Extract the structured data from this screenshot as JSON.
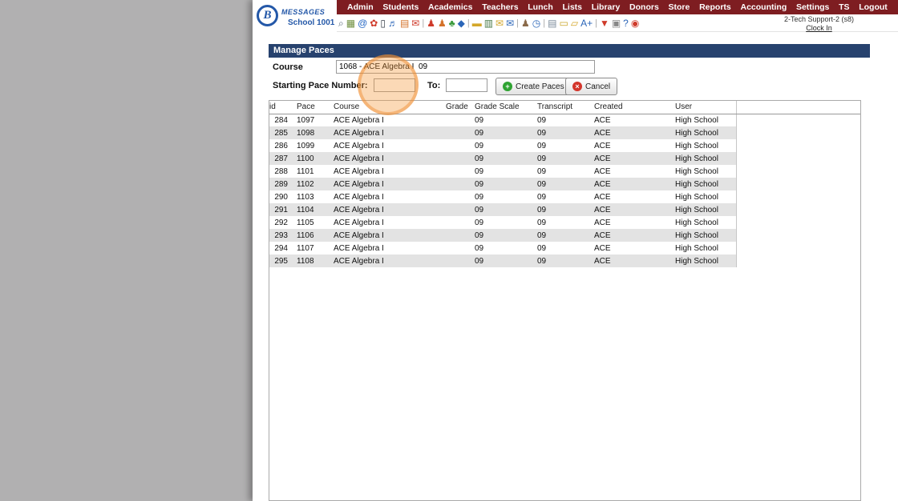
{
  "logo": {
    "initial": "B",
    "brand": "MESSAGES",
    "school": "School 1001"
  },
  "nav": {
    "items": [
      "Admin",
      "Students",
      "Academics",
      "Teachers",
      "Lunch",
      "Lists",
      "Library",
      "Donors",
      "Store",
      "Reports",
      "Accounting",
      "Settings",
      "TS",
      "Logout"
    ]
  },
  "toolbar": {
    "icons": [
      {
        "name": "search-icon",
        "glyph": "⌕",
        "color": "#5a6b7a"
      },
      {
        "name": "calendar-grid-icon",
        "glyph": "▦",
        "color": "#6f8f3f"
      },
      {
        "name": "at-icon",
        "glyph": "@",
        "color": "#1f63c4"
      },
      {
        "name": "flower-icon",
        "glyph": "✿",
        "color": "#cf3a2a"
      },
      {
        "name": "mobile-phone-icon",
        "glyph": "▯",
        "color": "#333a44"
      },
      {
        "name": "speaker-icon",
        "glyph": "♬",
        "color": "#2b66b8"
      },
      {
        "name": "calendar-icon",
        "glyph": "▤",
        "color": "#d4722a"
      },
      {
        "name": "mail-icon",
        "glyph": "✉",
        "color": "#cf3a2a"
      },
      {
        "name": "separator",
        "glyph": "|",
        "color": "#aaa"
      },
      {
        "name": "person-red-icon",
        "glyph": "♟",
        "color": "#cf3a2a"
      },
      {
        "name": "person-orange-icon",
        "glyph": "♟",
        "color": "#d4722a"
      },
      {
        "name": "leaf-icon",
        "glyph": "♣",
        "color": "#3a9a3a"
      },
      {
        "name": "bird-icon",
        "glyph": "◆",
        "color": "#2b66b8"
      },
      {
        "name": "separator",
        "glyph": "|",
        "color": "#aaa"
      },
      {
        "name": "briefcase-icon",
        "glyph": "▬",
        "color": "#d4a72a"
      },
      {
        "name": "notebook-icon",
        "glyph": "▥",
        "color": "#4a7a4a"
      },
      {
        "name": "mail-yellow-icon",
        "glyph": "✉",
        "color": "#d4a72a"
      },
      {
        "name": "mail-blue-icon",
        "glyph": "✉",
        "color": "#2b66b8"
      },
      {
        "name": "separator",
        "glyph": "|",
        "color": "#aaa"
      },
      {
        "name": "person-brown-icon",
        "glyph": "♟",
        "color": "#8a6a4a"
      },
      {
        "name": "clock-icon",
        "glyph": "◷",
        "color": "#2b66b8"
      },
      {
        "name": "separator",
        "glyph": "|",
        "color": "#aaa"
      },
      {
        "name": "ledger-icon",
        "glyph": "▤",
        "color": "#7a8a9a"
      },
      {
        "name": "card-icon",
        "glyph": "▭",
        "color": "#caa52a"
      },
      {
        "name": "folder-icon",
        "glyph": "▱",
        "color": "#d4a72a"
      },
      {
        "name": "grade-aplus-icon",
        "glyph": "A+",
        "color": "#2b66b8"
      },
      {
        "name": "separator",
        "glyph": "|",
        "color": "#aaa"
      },
      {
        "name": "pdf-icon",
        "glyph": "▼",
        "color": "#cf3a2a"
      },
      {
        "name": "printer-icon",
        "glyph": "▣",
        "color": "#888888"
      },
      {
        "name": "help-icon",
        "glyph": "?",
        "color": "#2b66b8"
      },
      {
        "name": "power-icon",
        "glyph": "◉",
        "color": "#cf3a2a"
      }
    ]
  },
  "user_panel": {
    "user": "2-Tech Support-2 (s8)",
    "clock_in": "Clock In"
  },
  "page": {
    "title": "Manage Paces",
    "course_label": "Course",
    "course_value": "1068 - ACE Algebra I  09",
    "starting_pace_label": "Starting Pace Number:",
    "starting_pace_value": "",
    "to_label": "To:",
    "to_value": "",
    "create_button": "Create Paces",
    "create_icon": "+",
    "cancel_button": "Cancel",
    "cancel_icon": "×"
  },
  "colors": {
    "nav_bg": "#7e1d21",
    "title_bg": "#27426e",
    "create": "#2fa332",
    "cancel": "#d3352b",
    "highlight": "#f59b40"
  },
  "table": {
    "headers": [
      "id",
      "Pace",
      "Course",
      "Grade",
      "Grade Scale",
      "Transcript",
      "Created",
      "User"
    ],
    "rows": [
      [
        "284",
        "1097",
        "ACE Algebra I",
        "",
        "09",
        "09",
        "ACE",
        "High School"
      ],
      [
        "285",
        "1098",
        "ACE Algebra I",
        "",
        "09",
        "09",
        "ACE",
        "High School"
      ],
      [
        "286",
        "1099",
        "ACE Algebra I",
        "",
        "09",
        "09",
        "ACE",
        "High School"
      ],
      [
        "287",
        "1100",
        "ACE Algebra I",
        "",
        "09",
        "09",
        "ACE",
        "High School"
      ],
      [
        "288",
        "1101",
        "ACE Algebra I",
        "",
        "09",
        "09",
        "ACE",
        "High School"
      ],
      [
        "289",
        "1102",
        "ACE Algebra I",
        "",
        "09",
        "09",
        "ACE",
        "High School"
      ],
      [
        "290",
        "1103",
        "ACE Algebra I",
        "",
        "09",
        "09",
        "ACE",
        "High School"
      ],
      [
        "291",
        "1104",
        "ACE Algebra I",
        "",
        "09",
        "09",
        "ACE",
        "High School"
      ],
      [
        "292",
        "1105",
        "ACE Algebra I",
        "",
        "09",
        "09",
        "ACE",
        "High School"
      ],
      [
        "293",
        "1106",
        "ACE Algebra I",
        "",
        "09",
        "09",
        "ACE",
        "High School"
      ],
      [
        "294",
        "1107",
        "ACE Algebra I",
        "",
        "09",
        "09",
        "ACE",
        "High School"
      ],
      [
        "295",
        "1108",
        "ACE Algebra I",
        "",
        "09",
        "09",
        "ACE",
        "High School"
      ]
    ]
  }
}
